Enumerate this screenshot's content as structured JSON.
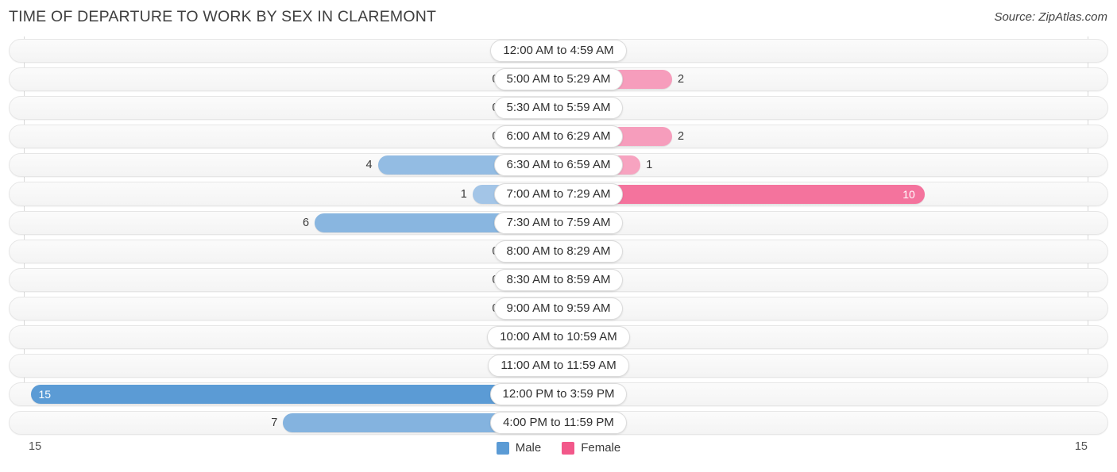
{
  "header": {
    "title": "TIME OF DEPARTURE TO WORK BY SEX IN CLAREMONT",
    "source": "Source: ZipAtlas.com"
  },
  "legend": {
    "items": [
      {
        "label": "Male",
        "color": "#5b9bd5"
      },
      {
        "label": "Female",
        "color": "#f2588a"
      }
    ]
  },
  "axis": {
    "left_label": "15",
    "right_label": "15"
  },
  "colors": {
    "male_base": "#5b9bd5",
    "male_pale": "#a8c8e8",
    "female_base": "#f2588a",
    "female_pale": "#f7a8c4",
    "background": "#ffffff",
    "track": "#f6f6f6"
  },
  "chart_data": {
    "type": "bar",
    "title": "TIME OF DEPARTURE TO WORK BY SEX IN CLAREMONT",
    "subtitle": "Source: ZipAtlas.com",
    "orientation": "horizontal-diverging",
    "xlabel": "",
    "ylabel": "",
    "xlim": [
      15,
      15
    ],
    "axis_max": 15,
    "grid": false,
    "legend_position": "bottom-center",
    "categories": [
      "12:00 AM to 4:59 AM",
      "5:00 AM to 5:29 AM",
      "5:30 AM to 5:59 AM",
      "6:00 AM to 6:29 AM",
      "6:30 AM to 6:59 AM",
      "7:00 AM to 7:29 AM",
      "7:30 AM to 7:59 AM",
      "8:00 AM to 8:29 AM",
      "8:30 AM to 8:59 AM",
      "9:00 AM to 9:59 AM",
      "10:00 AM to 10:59 AM",
      "11:00 AM to 11:59 AM",
      "12:00 PM to 3:59 PM",
      "4:00 PM to 11:59 PM"
    ],
    "series": [
      {
        "name": "Male",
        "side": "left",
        "color": "#5b9bd5",
        "values": [
          0,
          0,
          0,
          0,
          4,
          1,
          6,
          0,
          0,
          0,
          0,
          0,
          15,
          7
        ]
      },
      {
        "name": "Female",
        "side": "right",
        "color": "#f2588a",
        "values": [
          0,
          2,
          0,
          2,
          1,
          10,
          0,
          0,
          0,
          0,
          0,
          0,
          0,
          0
        ]
      }
    ]
  }
}
